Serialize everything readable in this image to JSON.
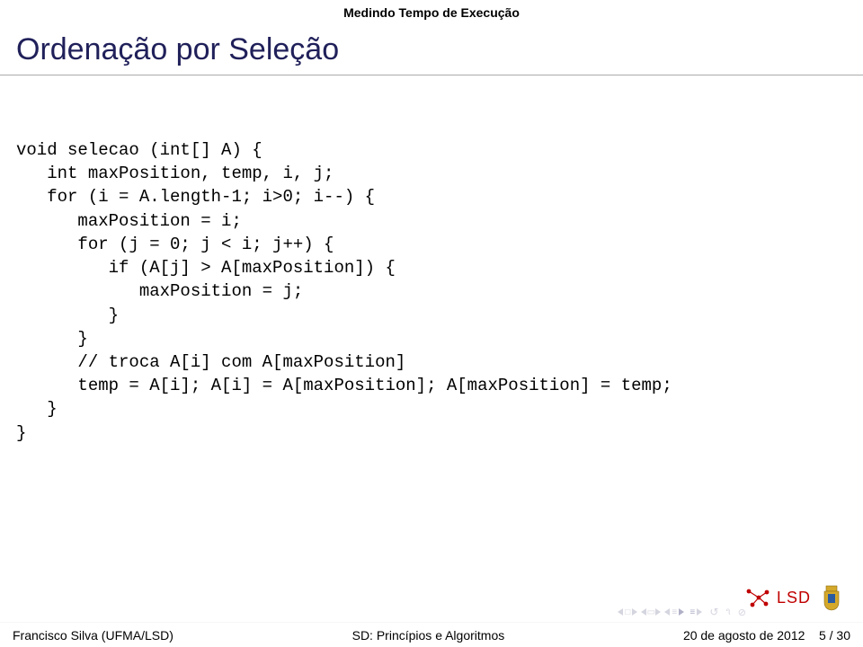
{
  "header": {
    "section": "Medindo Tempo de Execução",
    "title": "Ordenação por Seleção"
  },
  "code": "void selecao (int[] A) {\n   int maxPosition, temp, i, j;\n   for (i = A.length-1; i>0; i--) {\n      maxPosition = i;\n      for (j = 0; j < i; j++) {\n         if (A[j] > A[maxPosition]) {\n            maxPosition = j;\n         }\n      }\n      // troca A[i] com A[maxPosition]\n      temp = A[i]; A[i] = A[maxPosition]; A[maxPosition] = temp;\n   }\n}",
  "logo": {
    "text": "LSD"
  },
  "footer": {
    "author": "Francisco Silva (UFMA/LSD)",
    "course": "SD: Princípios e Algoritmos",
    "date": "20 de agosto de 2012",
    "page": "5 / 30"
  }
}
